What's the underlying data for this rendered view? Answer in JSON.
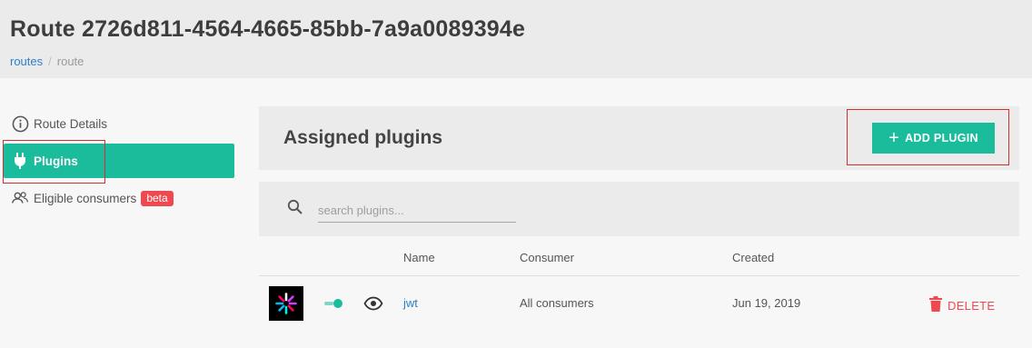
{
  "header": {
    "title": "Route 2726d811-4564-4665-85bb-7a9a0089394e",
    "breadcrumb": {
      "link": "routes",
      "separator": "/",
      "current": "route"
    }
  },
  "sidebar": {
    "items": [
      {
        "label": "Route Details",
        "icon": "info-icon"
      },
      {
        "label": "Plugins",
        "icon": "plug-icon",
        "active": true
      },
      {
        "label": "Eligible consumers",
        "icon": "users-icon",
        "badge": "beta"
      }
    ]
  },
  "main": {
    "title": "Assigned plugins",
    "add_button": "ADD PLUGIN",
    "search": {
      "placeholder": "search plugins..."
    },
    "table": {
      "columns": [
        "Name",
        "Consumer",
        "Created"
      ],
      "rows": [
        {
          "name": "jwt",
          "consumer": "All consumers",
          "created": "Jun 19, 2019",
          "action": "DELETE",
          "enabled": true
        }
      ]
    }
  },
  "colors": {
    "accent": "#1abc9c",
    "link": "#2e7fc6",
    "danger": "#f0484f"
  }
}
